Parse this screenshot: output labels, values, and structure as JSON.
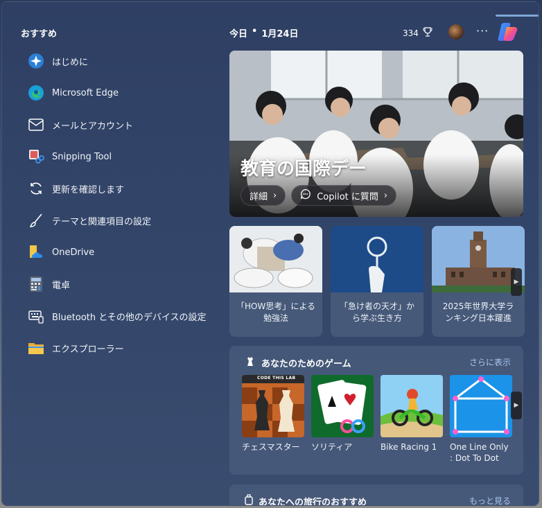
{
  "recommended": {
    "title": "おすすめ",
    "items": [
      {
        "label": "はじめに",
        "icon": "get-started-icon"
      },
      {
        "label": "Microsoft Edge",
        "icon": "edge-icon"
      },
      {
        "label": "メールとアカウント",
        "icon": "mail-icon"
      },
      {
        "label": "Snipping Tool",
        "icon": "snipping-tool-icon"
      },
      {
        "label": "更新を確認します",
        "icon": "refresh-icon"
      },
      {
        "label": "テーマと関連項目の設定",
        "icon": "brush-icon"
      },
      {
        "label": "OneDrive",
        "icon": "onedrive-icon"
      },
      {
        "label": "電卓",
        "icon": "calculator-icon"
      },
      {
        "label": "Bluetooth とその他のデバイスの設定",
        "icon": "devices-icon"
      },
      {
        "label": "エクスプローラー",
        "icon": "folder-icon"
      }
    ]
  },
  "header": {
    "today": "今日",
    "separator": "•",
    "date": "1月24日",
    "score": "334"
  },
  "hero": {
    "title": "教育の国際デー",
    "details_label": "詳細",
    "copilot_label": "Copilot に質問"
  },
  "news": [
    {
      "text": "「HOW思考」による勉強法"
    },
    {
      "text": "「急け者の天才」から学ぶ生き方"
    },
    {
      "text": "2025年世界大学ランキング日本躍進"
    }
  ],
  "games": {
    "title": "あなたのためのゲーム",
    "more": "さらに表示",
    "items": [
      {
        "label": "チェスマスター",
        "badge": "CODE THIS LAB"
      },
      {
        "label": "ソリティア"
      },
      {
        "label": "Bike Racing 1"
      },
      {
        "label": "One Line Only : Dot To Dot"
      }
    ]
  },
  "travel": {
    "title": "あなたへの旅行のおすすめ",
    "more": "もっと見る"
  },
  "colors": {
    "panel": "#34476b",
    "accent_link": "#a9c8f0"
  }
}
